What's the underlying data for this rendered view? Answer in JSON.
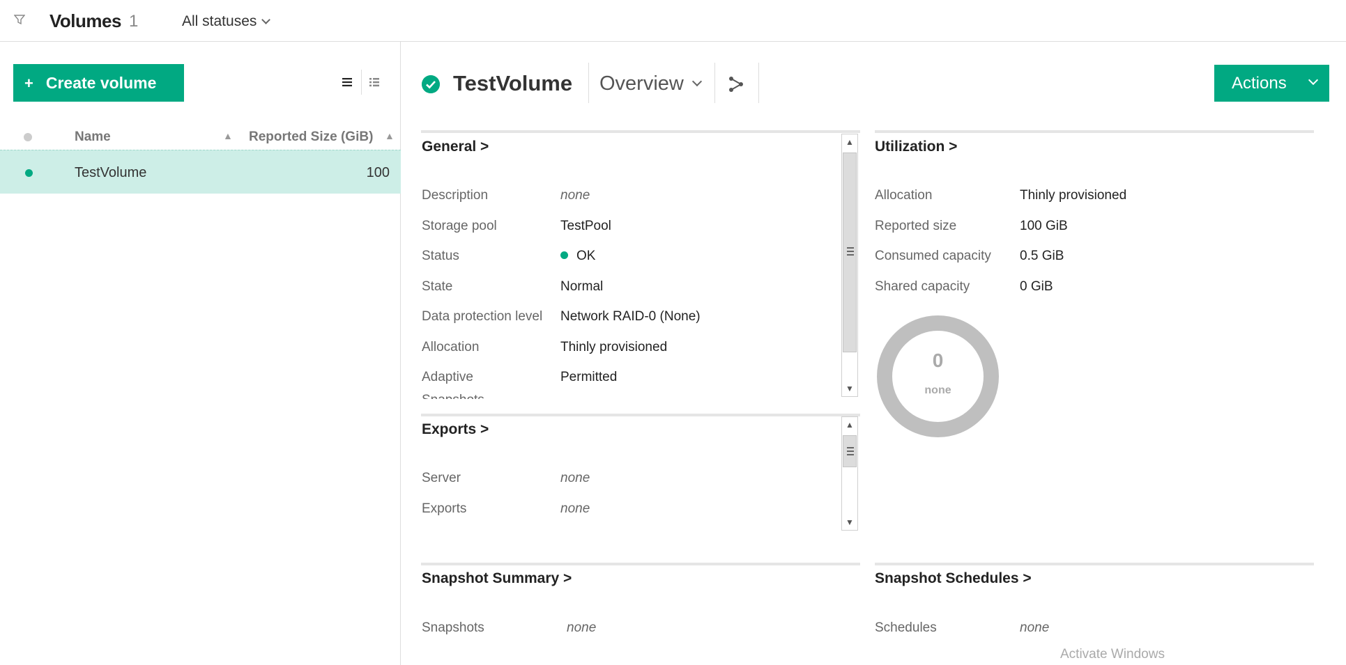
{
  "topbar": {
    "title": "Volumes",
    "count": "1",
    "status_filter": "All statuses"
  },
  "left": {
    "create_label": "Create volume",
    "create_plus": "+",
    "table": {
      "col_name": "Name",
      "col_size": "Reported Size (GiB)",
      "sort_indicator": "▲",
      "rows": [
        {
          "name": "TestVolume",
          "size": "100"
        }
      ]
    }
  },
  "detail": {
    "title": "TestVolume",
    "view": "Overview",
    "actions_label": "Actions",
    "general": {
      "title": "General >",
      "items": [
        {
          "label": "Description",
          "value": "none"
        },
        {
          "label": "Storage pool",
          "value": "TestPool"
        },
        {
          "label": "Status",
          "value": "OK"
        },
        {
          "label": "State",
          "value": "Normal"
        },
        {
          "label": "Data protection level",
          "value": "Network RAID-0 (None)"
        },
        {
          "label": "Allocation",
          "value": "Thinly provisioned"
        },
        {
          "label": "Adaptive",
          "value": "Permitted"
        },
        {
          "label": "Snapshots",
          "value": ""
        }
      ]
    },
    "exports": {
      "title": "Exports >",
      "items": [
        {
          "label": "Server",
          "value": "none"
        },
        {
          "label": "Exports",
          "value": "none"
        }
      ]
    },
    "utilization": {
      "title": "Utilization >",
      "items": [
        {
          "label": "Allocation",
          "value": "Thinly provisioned"
        },
        {
          "label": "Reported size",
          "value": "100 GiB"
        },
        {
          "label": "Consumed capacity",
          "value": "0.5 GiB"
        },
        {
          "label": "Shared capacity",
          "value": "0 GiB"
        }
      ],
      "donut_value": "0",
      "donut_label": "none"
    },
    "snapshot_summary": {
      "title": "Snapshot Summary >",
      "label": "Snapshots",
      "value": "none"
    },
    "snapshot_schedules": {
      "title": "Snapshot Schedules >",
      "label": "Schedules",
      "value": "none"
    }
  },
  "watermark": "Activate Windows",
  "colors": {
    "accent": "#01a982",
    "selected_row": "#cdeee7",
    "donut": "#bfbfbf"
  }
}
